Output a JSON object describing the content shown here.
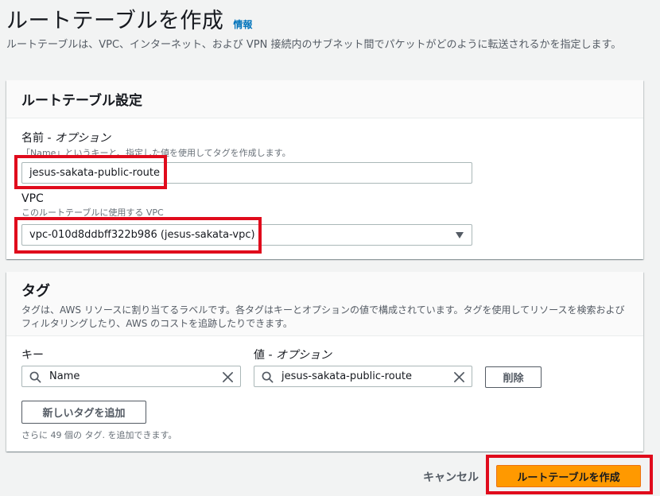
{
  "header": {
    "title": "ルートテーブルを作成",
    "info_link": "情報",
    "description": "ルートテーブルは、VPC、インターネット、および VPN 接続内のサブネット間でパケットがどのように転送されるかを指定します。"
  },
  "settings": {
    "title": "ルートテーブル設定",
    "name_label": "名前 - ",
    "name_optional": "オプション",
    "name_hint": "「Name」というキーと、指定した値を使用してタグを作成します。",
    "name_value": "jesus-sakata-public-route",
    "vpc_label": "VPC",
    "vpc_hint": "このルートテーブルに使用する VPC",
    "vpc_value": "vpc-010d8ddbff322b986 (jesus-sakata-vpc)"
  },
  "tags": {
    "title": "タグ",
    "description": "タグは、AWS リソースに割り当てるラベルです。各タグはキーとオプションの値で構成されています。タグを使用してリソースを検索およびフィルタリングしたり、AWS のコストを追跡したりできます。",
    "key_label": "キー",
    "value_label": "値 - ",
    "value_optional": "オプション",
    "key_value": "Name",
    "value_value": "jesus-sakata-public-route",
    "delete_label": "削除",
    "add_tag_label": "新しいタグを追加",
    "remaining_text": "さらに 49 個の タグ. を追加できます。"
  },
  "footer": {
    "cancel_label": "キャンセル",
    "create_label": "ルートテーブルを作成"
  },
  "colors": {
    "primary": "#ff9900",
    "link": "#0073bb",
    "highlight": "#e00b1c"
  }
}
